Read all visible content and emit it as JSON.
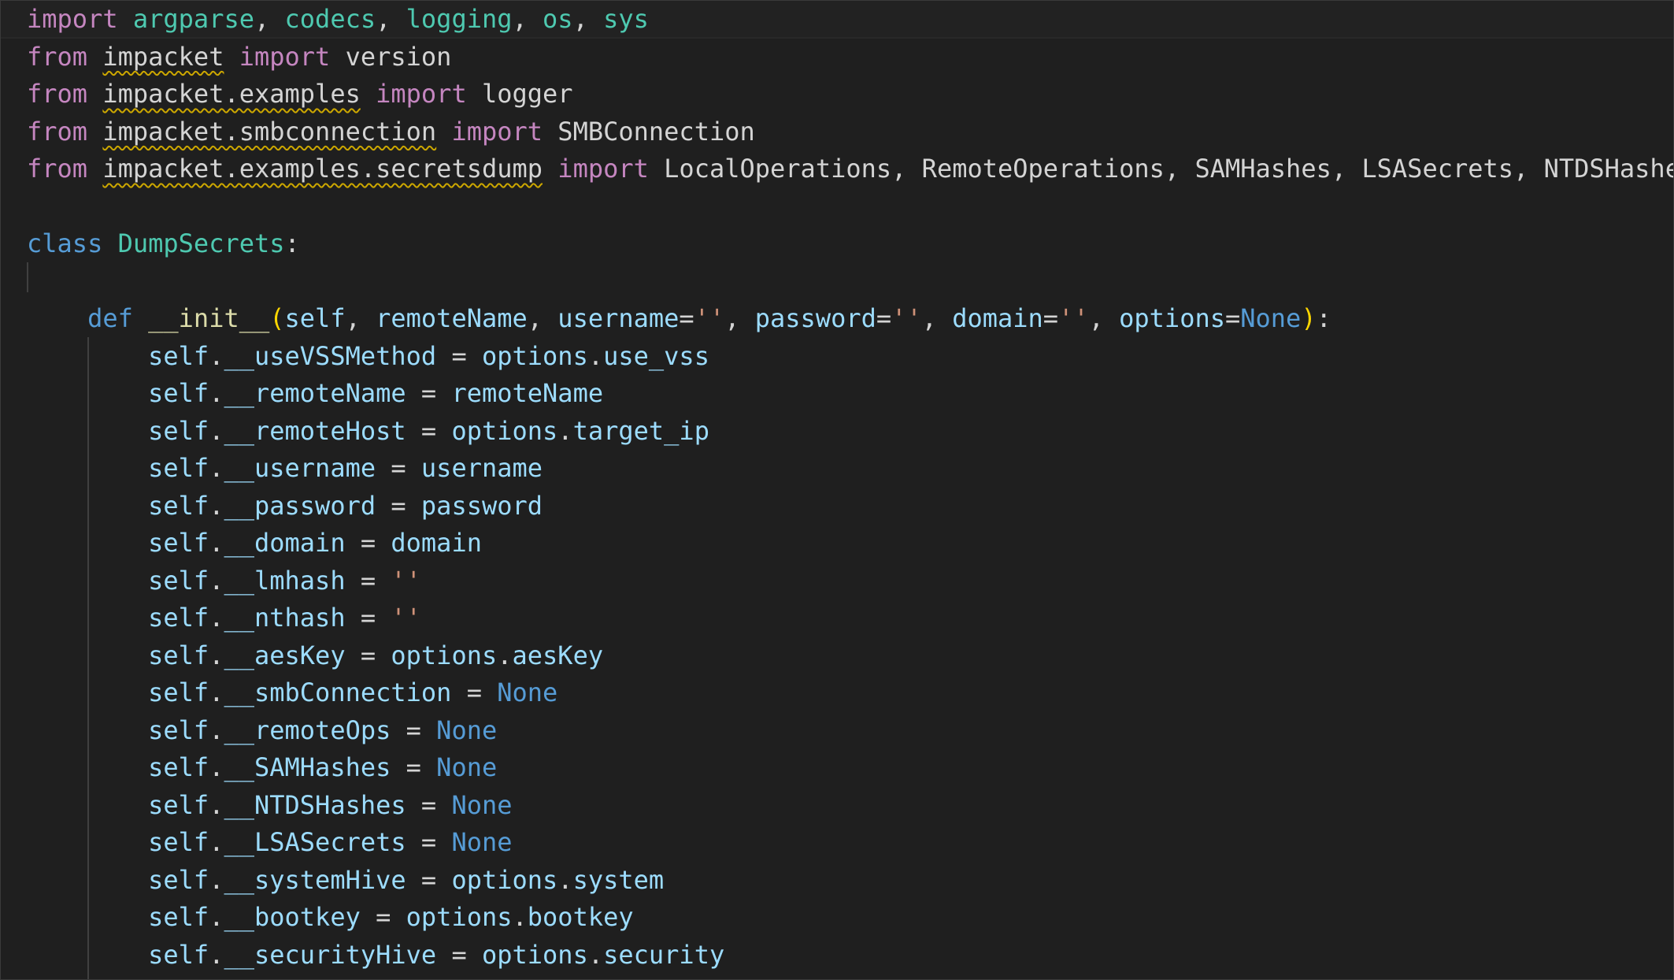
{
  "editor": {
    "language": "python",
    "theme": "dark",
    "colors": {
      "background": "#1f1f1f",
      "keyword": "#c586c0",
      "storage": "#569cd6",
      "class_name": "#4ec9b0",
      "function": "#dcdcaa",
      "variable": "#9cdcfe",
      "string": "#ce9178",
      "constant": "#569cd6",
      "plain": "#d4d4d4",
      "bracket": "#ffd700",
      "warning_squiggle": "#cca700"
    },
    "lines": [
      [
        {
          "t": "import",
          "k": "kw"
        },
        {
          "t": " ",
          "k": "pun"
        },
        {
          "t": "argparse",
          "k": "cls"
        },
        {
          "t": ", ",
          "k": "pun"
        },
        {
          "t": "codecs",
          "k": "cls"
        },
        {
          "t": ", ",
          "k": "pun"
        },
        {
          "t": "logging",
          "k": "cls"
        },
        {
          "t": ", ",
          "k": "pun"
        },
        {
          "t": "os",
          "k": "cls"
        },
        {
          "t": ", ",
          "k": "pun"
        },
        {
          "t": "sys",
          "k": "cls"
        }
      ],
      [
        {
          "t": "from",
          "k": "kw"
        },
        {
          "t": " ",
          "k": "pun"
        },
        {
          "t": "impacket",
          "k": "mod",
          "squiggle": true
        },
        {
          "t": " ",
          "k": "pun"
        },
        {
          "t": "import",
          "k": "kw"
        },
        {
          "t": " version",
          "k": "pun"
        }
      ],
      [
        {
          "t": "from",
          "k": "kw"
        },
        {
          "t": " ",
          "k": "pun"
        },
        {
          "t": "impacket.examples",
          "k": "mod",
          "squiggle": true
        },
        {
          "t": " ",
          "k": "pun"
        },
        {
          "t": "import",
          "k": "kw"
        },
        {
          "t": " logger",
          "k": "pun"
        }
      ],
      [
        {
          "t": "from",
          "k": "kw"
        },
        {
          "t": " ",
          "k": "pun"
        },
        {
          "t": "impacket.smbconnection",
          "k": "mod",
          "squiggle": true
        },
        {
          "t": " ",
          "k": "pun"
        },
        {
          "t": "import",
          "k": "kw"
        },
        {
          "t": " SMBConnection",
          "k": "pun"
        }
      ],
      [
        {
          "t": "from",
          "k": "kw"
        },
        {
          "t": " ",
          "k": "pun"
        },
        {
          "t": "impacket.examples.secretsdump",
          "k": "mod",
          "squiggle": true
        },
        {
          "t": " ",
          "k": "pun"
        },
        {
          "t": "import",
          "k": "kw"
        },
        {
          "t": " LocalOperations, RemoteOperations, SAMHashes, LSASecrets, NTDSHashes",
          "k": "pun"
        }
      ],
      [],
      [
        {
          "t": "class",
          "k": "def"
        },
        {
          "t": " ",
          "k": "pun"
        },
        {
          "t": "DumpSecrets",
          "k": "cls"
        },
        {
          "t": ":",
          "k": "pun"
        }
      ],
      [],
      [
        {
          "t": "    ",
          "k": "pun"
        },
        {
          "t": "def",
          "k": "def"
        },
        {
          "t": " ",
          "k": "pun"
        },
        {
          "t": "__init__",
          "k": "fn"
        },
        {
          "t": "(",
          "k": "br"
        },
        {
          "t": "self",
          "k": "var"
        },
        {
          "t": ", ",
          "k": "pun"
        },
        {
          "t": "remoteName",
          "k": "var"
        },
        {
          "t": ", ",
          "k": "pun"
        },
        {
          "t": "username",
          "k": "var"
        },
        {
          "t": "=",
          "k": "pun"
        },
        {
          "t": "''",
          "k": "str"
        },
        {
          "t": ", ",
          "k": "pun"
        },
        {
          "t": "password",
          "k": "var"
        },
        {
          "t": "=",
          "k": "pun"
        },
        {
          "t": "''",
          "k": "str"
        },
        {
          "t": ", ",
          "k": "pun"
        },
        {
          "t": "domain",
          "k": "var"
        },
        {
          "t": "=",
          "k": "pun"
        },
        {
          "t": "''",
          "k": "str"
        },
        {
          "t": ", ",
          "k": "pun"
        },
        {
          "t": "options",
          "k": "var"
        },
        {
          "t": "=",
          "k": "pun"
        },
        {
          "t": "None",
          "k": "const"
        },
        {
          "t": ")",
          "k": "br"
        },
        {
          "t": ":",
          "k": "pun"
        }
      ],
      [
        {
          "t": "        ",
          "k": "pun"
        },
        {
          "t": "self",
          "k": "var"
        },
        {
          "t": ".",
          "k": "pun"
        },
        {
          "t": "__useVSSMethod",
          "k": "var"
        },
        {
          "t": " = ",
          "k": "pun"
        },
        {
          "t": "options",
          "k": "var"
        },
        {
          "t": ".",
          "k": "pun"
        },
        {
          "t": "use_vss",
          "k": "var"
        }
      ],
      [
        {
          "t": "        ",
          "k": "pun"
        },
        {
          "t": "self",
          "k": "var"
        },
        {
          "t": ".",
          "k": "pun"
        },
        {
          "t": "__remoteName",
          "k": "var"
        },
        {
          "t": " = ",
          "k": "pun"
        },
        {
          "t": "remoteName",
          "k": "var"
        }
      ],
      [
        {
          "t": "        ",
          "k": "pun"
        },
        {
          "t": "self",
          "k": "var"
        },
        {
          "t": ".",
          "k": "pun"
        },
        {
          "t": "__remoteHost",
          "k": "var"
        },
        {
          "t": " = ",
          "k": "pun"
        },
        {
          "t": "options",
          "k": "var"
        },
        {
          "t": ".",
          "k": "pun"
        },
        {
          "t": "target_ip",
          "k": "var"
        }
      ],
      [
        {
          "t": "        ",
          "k": "pun"
        },
        {
          "t": "self",
          "k": "var"
        },
        {
          "t": ".",
          "k": "pun"
        },
        {
          "t": "__username",
          "k": "var"
        },
        {
          "t": " = ",
          "k": "pun"
        },
        {
          "t": "username",
          "k": "var"
        }
      ],
      [
        {
          "t": "        ",
          "k": "pun"
        },
        {
          "t": "self",
          "k": "var"
        },
        {
          "t": ".",
          "k": "pun"
        },
        {
          "t": "__password",
          "k": "var"
        },
        {
          "t": " = ",
          "k": "pun"
        },
        {
          "t": "password",
          "k": "var"
        }
      ],
      [
        {
          "t": "        ",
          "k": "pun"
        },
        {
          "t": "self",
          "k": "var"
        },
        {
          "t": ".",
          "k": "pun"
        },
        {
          "t": "__domain",
          "k": "var"
        },
        {
          "t": " = ",
          "k": "pun"
        },
        {
          "t": "domain",
          "k": "var"
        }
      ],
      [
        {
          "t": "        ",
          "k": "pun"
        },
        {
          "t": "self",
          "k": "var"
        },
        {
          "t": ".",
          "k": "pun"
        },
        {
          "t": "__lmhash",
          "k": "var"
        },
        {
          "t": " = ",
          "k": "pun"
        },
        {
          "t": "''",
          "k": "str"
        }
      ],
      [
        {
          "t": "        ",
          "k": "pun"
        },
        {
          "t": "self",
          "k": "var"
        },
        {
          "t": ".",
          "k": "pun"
        },
        {
          "t": "__nthash",
          "k": "var"
        },
        {
          "t": " = ",
          "k": "pun"
        },
        {
          "t": "''",
          "k": "str"
        }
      ],
      [
        {
          "t": "        ",
          "k": "pun"
        },
        {
          "t": "self",
          "k": "var"
        },
        {
          "t": ".",
          "k": "pun"
        },
        {
          "t": "__aesKey",
          "k": "var"
        },
        {
          "t": " = ",
          "k": "pun"
        },
        {
          "t": "options",
          "k": "var"
        },
        {
          "t": ".",
          "k": "pun"
        },
        {
          "t": "aesKey",
          "k": "var"
        }
      ],
      [
        {
          "t": "        ",
          "k": "pun"
        },
        {
          "t": "self",
          "k": "var"
        },
        {
          "t": ".",
          "k": "pun"
        },
        {
          "t": "__smbConnection",
          "k": "var"
        },
        {
          "t": " = ",
          "k": "pun"
        },
        {
          "t": "None",
          "k": "const"
        }
      ],
      [
        {
          "t": "        ",
          "k": "pun"
        },
        {
          "t": "self",
          "k": "var"
        },
        {
          "t": ".",
          "k": "pun"
        },
        {
          "t": "__remoteOps",
          "k": "var"
        },
        {
          "t": " = ",
          "k": "pun"
        },
        {
          "t": "None",
          "k": "const"
        }
      ],
      [
        {
          "t": "        ",
          "k": "pun"
        },
        {
          "t": "self",
          "k": "var"
        },
        {
          "t": ".",
          "k": "pun"
        },
        {
          "t": "__SAMHashes",
          "k": "var"
        },
        {
          "t": " = ",
          "k": "pun"
        },
        {
          "t": "None",
          "k": "const"
        }
      ],
      [
        {
          "t": "        ",
          "k": "pun"
        },
        {
          "t": "self",
          "k": "var"
        },
        {
          "t": ".",
          "k": "pun"
        },
        {
          "t": "__NTDSHashes",
          "k": "var"
        },
        {
          "t": " = ",
          "k": "pun"
        },
        {
          "t": "None",
          "k": "const"
        }
      ],
      [
        {
          "t": "        ",
          "k": "pun"
        },
        {
          "t": "self",
          "k": "var"
        },
        {
          "t": ".",
          "k": "pun"
        },
        {
          "t": "__LSASecrets",
          "k": "var"
        },
        {
          "t": " = ",
          "k": "pun"
        },
        {
          "t": "None",
          "k": "const"
        }
      ],
      [
        {
          "t": "        ",
          "k": "pun"
        },
        {
          "t": "self",
          "k": "var"
        },
        {
          "t": ".",
          "k": "pun"
        },
        {
          "t": "__systemHive",
          "k": "var"
        },
        {
          "t": " = ",
          "k": "pun"
        },
        {
          "t": "options",
          "k": "var"
        },
        {
          "t": ".",
          "k": "pun"
        },
        {
          "t": "system",
          "k": "var"
        }
      ],
      [
        {
          "t": "        ",
          "k": "pun"
        },
        {
          "t": "self",
          "k": "var"
        },
        {
          "t": ".",
          "k": "pun"
        },
        {
          "t": "__bootkey",
          "k": "var"
        },
        {
          "t": " = ",
          "k": "pun"
        },
        {
          "t": "options",
          "k": "var"
        },
        {
          "t": ".",
          "k": "pun"
        },
        {
          "t": "bootkey",
          "k": "var"
        }
      ],
      [
        {
          "t": "        ",
          "k": "pun"
        },
        {
          "t": "self",
          "k": "var"
        },
        {
          "t": ".",
          "k": "pun"
        },
        {
          "t": "__securityHive",
          "k": "var"
        },
        {
          "t": " = ",
          "k": "pun"
        },
        {
          "t": "options",
          "k": "var"
        },
        {
          "t": ".",
          "k": "pun"
        },
        {
          "t": "security",
          "k": "var"
        }
      ]
    ]
  }
}
